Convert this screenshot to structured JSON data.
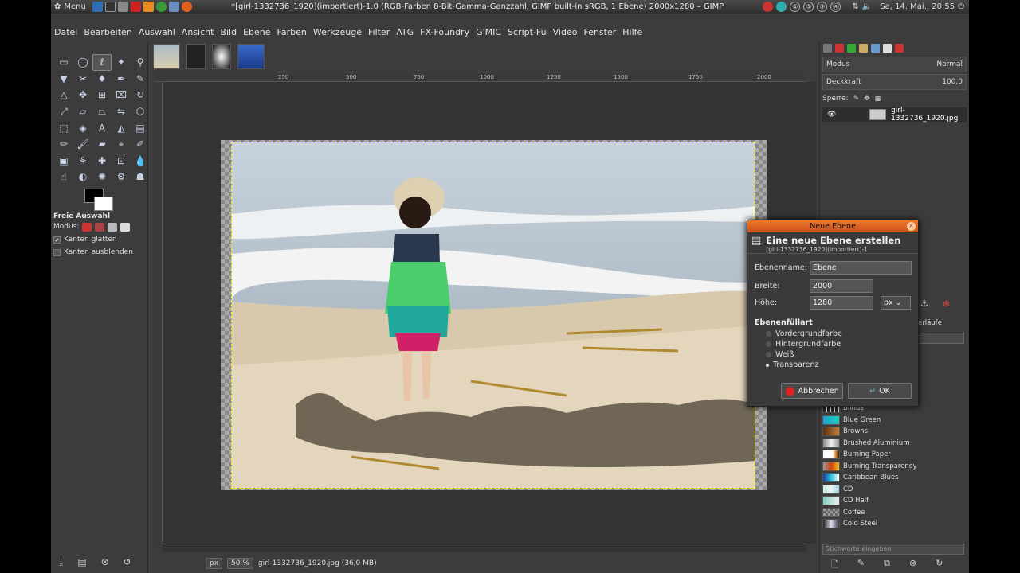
{
  "system": {
    "menu_label": "Menu",
    "window_title": "*[girl-1332736_1920](importiert)-1.0 (RGB-Farben 8-Bit-Gamma-Ganzzahl, GIMP built-in sRGB, 1 Ebene) 2000x1280 – GIMP",
    "tray_letters": [
      "①",
      "⑤",
      "⑨",
      "Ⓐ"
    ],
    "clock": "Sa, 14. Mai., 20:55"
  },
  "menubar": [
    "Datei",
    "Bearbeiten",
    "Auswahl",
    "Ansicht",
    "Bild",
    "Ebene",
    "Farben",
    "Werkzeuge",
    "Filter",
    "ATG",
    "FX-Foundry",
    "G'MIC",
    "Script-Fu",
    "Video",
    "Fenster",
    "Hilfe"
  ],
  "tool_options": {
    "title": "Freie Auswahl",
    "mode_label": "Modus:",
    "antialias_label": "Kanten glätten",
    "feather_label": "Kanten ausblenden"
  },
  "ruler_ticks": [
    "250",
    "500",
    "750",
    "1000",
    "1250",
    "1500",
    "1750",
    "2000"
  ],
  "statusbar": {
    "unit": "px",
    "zoom": "50 %",
    "file_info": "girl-1332736_1920.jpg (36,0 MB)"
  },
  "layers": {
    "mode_label": "Modus",
    "mode_value": "Normal",
    "opacity_label": "Deckkraft",
    "opacity_value": "100,0",
    "lock_label": "Sperre:",
    "layer_name": "girl-1332736_1920.jpg"
  },
  "gradients": {
    "tab_fragment": "erläufe",
    "items": [
      {
        "name": "Blinds",
        "color": "#222"
      },
      {
        "name": "Blue Green",
        "color": "#1aa0d0"
      },
      {
        "name": "Browns",
        "color": "#8a4a1a"
      },
      {
        "name": "Brushed Aluminium",
        "color": "#b8b8b8"
      },
      {
        "name": "Burning Paper",
        "color": "#e0a040"
      },
      {
        "name": "Burning Transparency",
        "color": "#d04010"
      },
      {
        "name": "Caribbean Blues",
        "color": "#1060c0"
      },
      {
        "name": "CD",
        "color": "#b0e0d0"
      },
      {
        "name": "CD Half",
        "color": "#90c8d8"
      },
      {
        "name": "Coffee",
        "color": "#6a4020"
      },
      {
        "name": "Cold Steel",
        "color": "#606878"
      }
    ],
    "search_placeholder": "Stichworte eingeben"
  },
  "dialog": {
    "window_title": "Neue Ebene",
    "heading": "Eine neue Ebene erstellen",
    "subheading": "[girl-1332736_1920](importiert)-1",
    "name_label": "Ebenenname:",
    "name_value": "Ebene",
    "width_label": "Breite:",
    "width_value": "2000",
    "height_label": "Höhe:",
    "height_value": "1280",
    "unit": "px",
    "fill_label": "Ebenenfüllart",
    "fill_options": [
      "Vordergrundfarbe",
      "Hintergrundfarbe",
      "Weiß",
      "Transparenz"
    ],
    "fill_selected": 3,
    "cancel_label": "Abbrechen",
    "ok_label": "OK"
  }
}
